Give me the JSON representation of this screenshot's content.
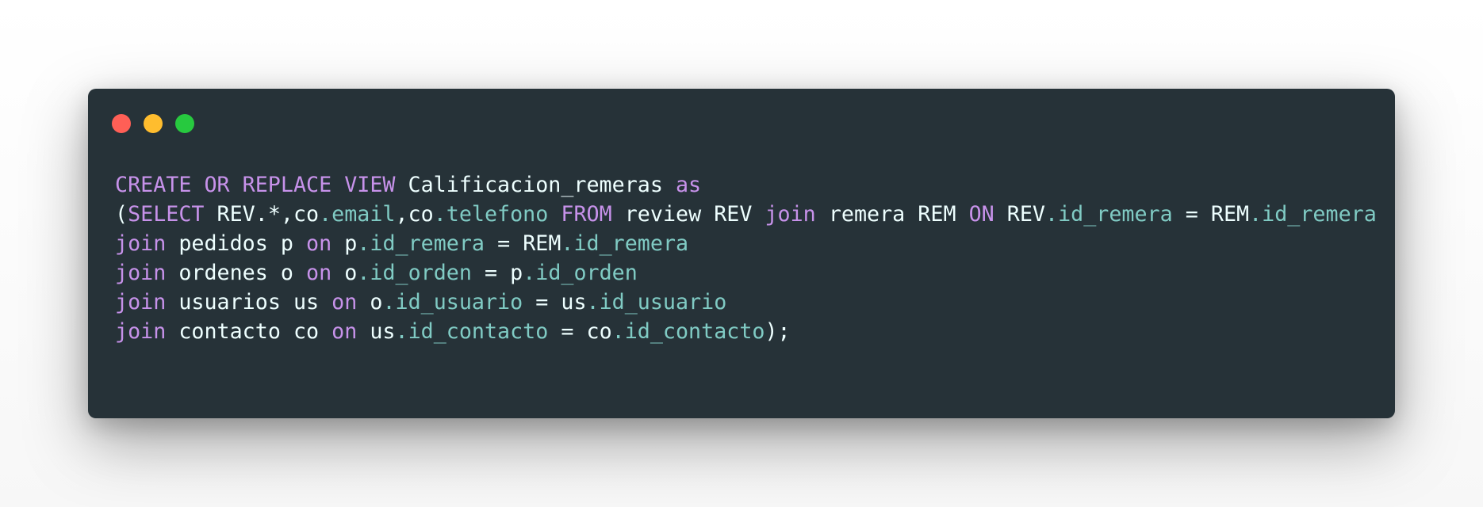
{
  "window": {
    "background": "#263238",
    "controls": [
      {
        "name": "close",
        "color": "#ff5f56"
      },
      {
        "name": "minimize",
        "color": "#ffbd2e"
      },
      {
        "name": "maximize",
        "color": "#27c93f"
      }
    ]
  },
  "theme": {
    "keyword": "#c792ea",
    "property": "#80cbc4",
    "plain": "#eeffff"
  },
  "code": {
    "language": "sql",
    "lines": [
      [
        {
          "t": "kw",
          "v": "CREATE OR REPLACE VIEW"
        },
        {
          "t": "plain",
          "v": " Calificacion_remeras "
        },
        {
          "t": "kw",
          "v": "as"
        }
      ],
      [
        {
          "t": "plain",
          "v": "("
        },
        {
          "t": "kw",
          "v": "SELECT"
        },
        {
          "t": "plain",
          "v": " REV.*,co"
        },
        {
          "t": "prop",
          "v": ".email"
        },
        {
          "t": "plain",
          "v": ",co"
        },
        {
          "t": "prop",
          "v": ".telefono"
        },
        {
          "t": "plain",
          "v": " "
        },
        {
          "t": "kw",
          "v": "FROM"
        },
        {
          "t": "plain",
          "v": " review REV "
        },
        {
          "t": "kw",
          "v": "join"
        },
        {
          "t": "plain",
          "v": " remera REM "
        },
        {
          "t": "kw",
          "v": "ON"
        },
        {
          "t": "plain",
          "v": " REV"
        },
        {
          "t": "prop",
          "v": ".id_remera"
        },
        {
          "t": "plain",
          "v": " = REM"
        },
        {
          "t": "prop",
          "v": ".id_remera"
        }
      ],
      [
        {
          "t": "kw",
          "v": "join"
        },
        {
          "t": "plain",
          "v": " pedidos p "
        },
        {
          "t": "kw",
          "v": "on"
        },
        {
          "t": "plain",
          "v": " p"
        },
        {
          "t": "prop",
          "v": ".id_remera"
        },
        {
          "t": "plain",
          "v": " = REM"
        },
        {
          "t": "prop",
          "v": ".id_remera"
        }
      ],
      [
        {
          "t": "kw",
          "v": "join"
        },
        {
          "t": "plain",
          "v": " ordenes o "
        },
        {
          "t": "kw",
          "v": "on"
        },
        {
          "t": "plain",
          "v": " o"
        },
        {
          "t": "prop",
          "v": ".id_orden"
        },
        {
          "t": "plain",
          "v": " = p"
        },
        {
          "t": "prop",
          "v": ".id_orden"
        }
      ],
      [
        {
          "t": "kw",
          "v": "join"
        },
        {
          "t": "plain",
          "v": " usuarios us "
        },
        {
          "t": "kw",
          "v": "on"
        },
        {
          "t": "plain",
          "v": " o"
        },
        {
          "t": "prop",
          "v": ".id_usuario"
        },
        {
          "t": "plain",
          "v": " = us"
        },
        {
          "t": "prop",
          "v": ".id_usuario"
        }
      ],
      [
        {
          "t": "kw",
          "v": "join"
        },
        {
          "t": "plain",
          "v": " contacto co "
        },
        {
          "t": "kw",
          "v": "on"
        },
        {
          "t": "plain",
          "v": " us"
        },
        {
          "t": "prop",
          "v": ".id_contacto"
        },
        {
          "t": "plain",
          "v": " = co"
        },
        {
          "t": "prop",
          "v": ".id_contacto"
        },
        {
          "t": "plain",
          "v": ");"
        }
      ]
    ]
  }
}
